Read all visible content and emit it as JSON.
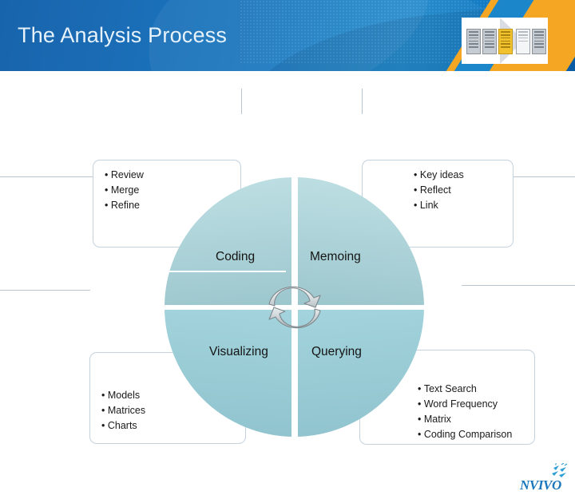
{
  "slide": {
    "title": "The Analysis Process"
  },
  "header": {
    "thumbnail_name": "slide-thumbnail",
    "accent_orange": "#f5a623",
    "banner_blue": "#0d63b0"
  },
  "diagram": {
    "type": "cycle-wheel",
    "quadrants": [
      {
        "id": "coding",
        "label": "Coding",
        "position": "top-left",
        "fill": "#9cc7cd"
      },
      {
        "id": "memoing",
        "label": "Memoing",
        "position": "top-right",
        "fill": "#9cc7cd"
      },
      {
        "id": "visualizing",
        "label": "Visualizing",
        "position": "bottom-left",
        "fill": "#a9d6de"
      },
      {
        "id": "querying",
        "label": "Querying",
        "position": "bottom-right",
        "fill": "#a9d6de"
      }
    ],
    "center_icon": "cycle-arrows-icon"
  },
  "callouts": {
    "coding": {
      "name": "coding-callout",
      "items": [
        "Review",
        "Merge",
        "Refine"
      ]
    },
    "memoing": {
      "name": "memoing-callout",
      "items": [
        "Key ideas",
        "Reflect",
        "Link"
      ]
    },
    "visualizing": {
      "name": "visualizing-callout",
      "items": [
        "Models",
        "Matrices",
        "Charts"
      ]
    },
    "querying": {
      "name": "querying-callout",
      "items": [
        "Text Search",
        "Word Frequency",
        "Matrix",
        "Coding Comparison"
      ]
    }
  },
  "logo": {
    "wordmark": "NVIVO",
    "color": "#1b76bc",
    "mark": "birds-icon"
  }
}
